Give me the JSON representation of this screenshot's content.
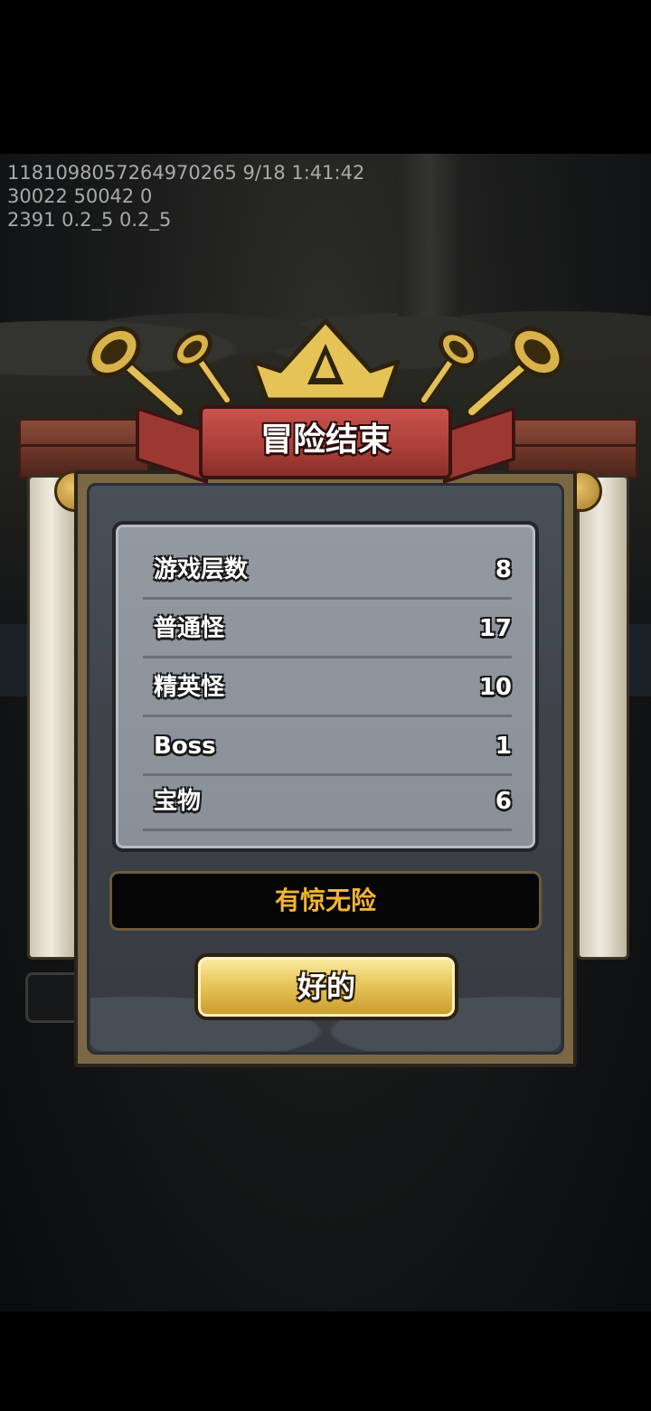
{
  "debug": {
    "line1": "1181098057264970265 9/18 1:41:42",
    "line2": "30022 50042 0",
    "line3": "2391 0.2_5 0.2_5"
  },
  "dialog": {
    "title": "冒险结束",
    "stats": [
      {
        "label": "游戏层数",
        "value": "8"
      },
      {
        "label": "普通怪",
        "value": "17"
      },
      {
        "label": "精英怪",
        "value": "10"
      },
      {
        "label": "Boss",
        "value": "1"
      },
      {
        "label": "宝物",
        "value": "6"
      }
    ],
    "rating": "有惊无险",
    "ok_label": "好的"
  },
  "colors": {
    "rating_text": "#f2b436",
    "banner_red": "#a93e38",
    "button_gold": "#e8c65a"
  },
  "icons": [
    "crown-icon",
    "trumpet-icon",
    "gear-icon"
  ]
}
